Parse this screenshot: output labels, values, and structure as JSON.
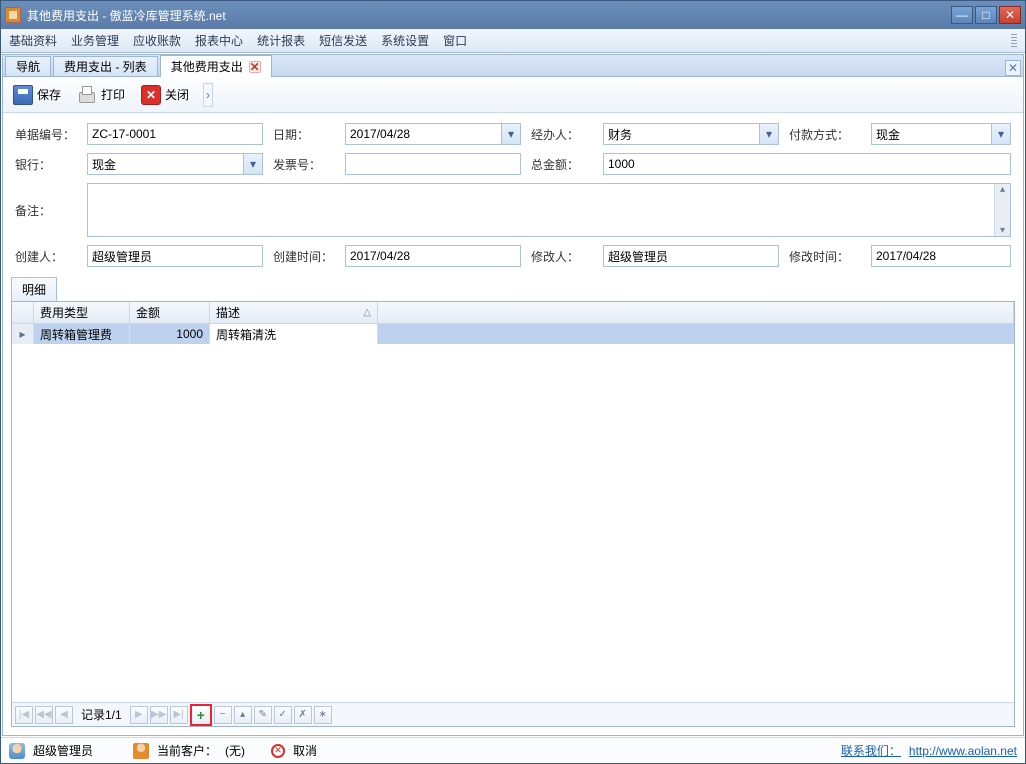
{
  "window": {
    "title": "其他费用支出 - 傲蓝冷库管理系统.net"
  },
  "menu": [
    "基础资料",
    "业务管理",
    "应收账款",
    "报表中心",
    "统计报表",
    "短信发送",
    "系统设置",
    "窗口"
  ],
  "tabs": [
    {
      "label": "导航",
      "closable": false,
      "active": false
    },
    {
      "label": "费用支出 - 列表",
      "closable": false,
      "active": false
    },
    {
      "label": "其他费用支出",
      "closable": true,
      "active": true
    }
  ],
  "toolbar": {
    "save": "保存",
    "print": "打印",
    "close": "关闭"
  },
  "form": {
    "labels": {
      "bill_no": "单据编号：",
      "date": "日期：",
      "handler": "经办人：",
      "pay_method": "付款方式：",
      "bank": "银行：",
      "invoice": "发票号：",
      "total": "总金额：",
      "remark": "备注：",
      "creator": "创建人：",
      "ctime": "创建时间：",
      "modifier": "修改人：",
      "mtime": "修改时间："
    },
    "values": {
      "bill_no": "ZC-17-0001",
      "date": "2017/04/28",
      "handler": "财务",
      "pay_method": "现金",
      "bank": "现金",
      "invoice": "",
      "total": "1000",
      "remark": "",
      "creator": "超级管理员",
      "ctime": "2017/04/28",
      "modifier": "超级管理员",
      "mtime": "2017/04/28"
    }
  },
  "detail": {
    "tab": "明细",
    "cols": {
      "type": "费用类型",
      "amount": "金额",
      "desc": "描述"
    },
    "rows": [
      {
        "type": "周转箱管理费",
        "amount": "1000",
        "desc": "周转箱清洗"
      }
    ],
    "nav": {
      "record": "记录1/1"
    }
  },
  "status": {
    "user": "超级管理员",
    "client_label": "当前客户：",
    "client_value": "(无)",
    "cancel": "取消",
    "contact": "联系我们：",
    "url": "http://www.aolan.net"
  }
}
